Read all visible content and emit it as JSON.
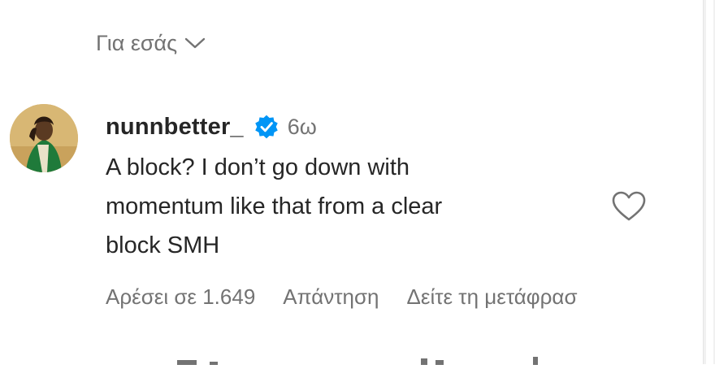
{
  "sort": {
    "label": "Για εσάς",
    "icon": "chevron-down-icon"
  },
  "comment": {
    "username": "nunnbetter_",
    "verified_icon": "verified-badge-icon",
    "time": "6ω",
    "text": "A block? I don’t go down with\nmomentum like that from a clear\nblock SMH",
    "like_icon": "heart-outline-icon",
    "actions": {
      "likes": "Αρέσει σε 1.649",
      "reply": "Απάντηση",
      "translate": "Δείτε τη μετάφρασ"
    }
  },
  "colors": {
    "text": "#262626",
    "secondary": "#737373",
    "verified": "#0095f6"
  }
}
